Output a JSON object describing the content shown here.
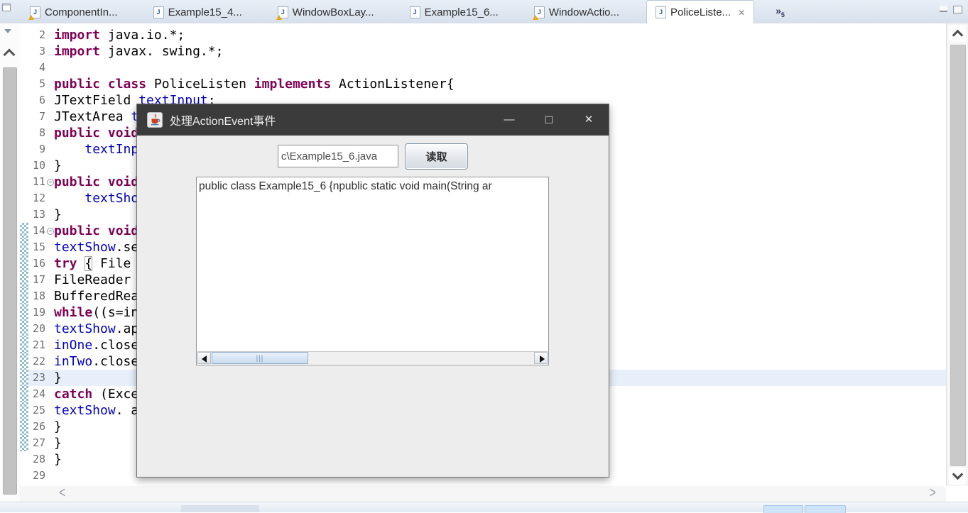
{
  "icons": {
    "close": "✕",
    "overflow": "»",
    "minimize": "—",
    "maximize": "□",
    "angle_left": "<",
    "angle_right": ">",
    "file_letter": "J",
    "grip": "|||"
  },
  "tab_bar": {
    "overflow_count": "5",
    "tabs": [
      {
        "label": "ComponentIn...",
        "warning": true,
        "active": false,
        "closable": false
      },
      {
        "label": "Example15_4...",
        "warning": false,
        "active": false,
        "closable": false
      },
      {
        "label": "WindowBoxLay...",
        "warning": true,
        "active": false,
        "closable": false
      },
      {
        "label": "Example15_6...",
        "warning": false,
        "active": false,
        "closable": false
      },
      {
        "label": "WindowActio...",
        "warning": true,
        "active": false,
        "closable": false
      },
      {
        "label": "PoliceListe...",
        "warning": false,
        "active": true,
        "closable": true
      }
    ]
  },
  "editor": {
    "current_line": 23,
    "fold_lines": [
      11,
      14
    ],
    "marker_range": [
      14,
      27
    ],
    "lines": [
      {
        "n": 2,
        "s": [
          [
            "k",
            "import"
          ],
          [
            "p",
            " java.io.*;"
          ]
        ]
      },
      {
        "n": 3,
        "s": [
          [
            "k",
            "import"
          ],
          [
            "p",
            " javax. swing.*;"
          ]
        ]
      },
      {
        "n": 4,
        "s": []
      },
      {
        "n": 5,
        "s": [
          [
            "k",
            "public"
          ],
          [
            "p",
            " "
          ],
          [
            "k",
            "class"
          ],
          [
            "p",
            " PoliceListen "
          ],
          [
            "k",
            "implements"
          ],
          [
            "p",
            " ActionListener{"
          ]
        ]
      },
      {
        "n": 6,
        "s": [
          [
            "p",
            "JTextField "
          ],
          [
            "e",
            "textInput"
          ],
          [
            "p",
            ";"
          ]
        ]
      },
      {
        "n": 7,
        "s": [
          [
            "p",
            "JTextArea "
          ],
          [
            "f",
            "textShow"
          ],
          [
            "p",
            ";"
          ]
        ]
      },
      {
        "n": 8,
        "s": [
          [
            "k",
            "public"
          ],
          [
            "p",
            " "
          ],
          [
            "k",
            "void"
          ]
        ]
      },
      {
        "n": 9,
        "s": [
          [
            "p",
            "    "
          ],
          [
            "f",
            "textInput"
          ]
        ]
      },
      {
        "n": 10,
        "s": [
          [
            "p",
            "}"
          ]
        ]
      },
      {
        "n": 11,
        "s": [
          [
            "k",
            "public"
          ],
          [
            "p",
            " "
          ],
          [
            "k",
            "void"
          ]
        ]
      },
      {
        "n": 12,
        "s": [
          [
            "p",
            "    "
          ],
          [
            "f",
            "textShow"
          ]
        ]
      },
      {
        "n": 13,
        "s": [
          [
            "p",
            "}"
          ]
        ]
      },
      {
        "n": 14,
        "s": [
          [
            "k",
            "public"
          ],
          [
            "p",
            " "
          ],
          [
            "k",
            "void"
          ]
        ]
      },
      {
        "n": 15,
        "s": [
          [
            "f",
            "textShow"
          ],
          [
            "p",
            ".se"
          ]
        ]
      },
      {
        "n": 16,
        "s": [
          [
            "k",
            "try"
          ],
          [
            "p",
            " "
          ],
          [
            "b",
            "{"
          ],
          [
            "p",
            " File"
          ]
        ]
      },
      {
        "n": 17,
        "s": [
          [
            "p",
            "FileReader "
          ]
        ]
      },
      {
        "n": 18,
        "s": [
          [
            "p",
            "BufferedRea"
          ]
        ]
      },
      {
        "n": 19,
        "s": [
          [
            "k",
            "while"
          ],
          [
            "p",
            "((s=in"
          ]
        ]
      },
      {
        "n": 20,
        "s": [
          [
            "f",
            "textShow"
          ],
          [
            "p",
            ".ap"
          ]
        ]
      },
      {
        "n": 21,
        "s": [
          [
            "f",
            "inOne"
          ],
          [
            "p",
            ".close"
          ]
        ]
      },
      {
        "n": 22,
        "s": [
          [
            "f",
            "inTwo"
          ],
          [
            "p",
            ".close"
          ]
        ]
      },
      {
        "n": 23,
        "s": [
          [
            "p",
            "}"
          ]
        ]
      },
      {
        "n": 24,
        "s": [
          [
            "k",
            "catch"
          ],
          [
            "p",
            " (Exce"
          ]
        ]
      },
      {
        "n": 25,
        "s": [
          [
            "f",
            "textShow"
          ],
          [
            "p",
            ". a"
          ]
        ]
      },
      {
        "n": 26,
        "s": [
          [
            "p",
            "}"
          ]
        ]
      },
      {
        "n": 27,
        "s": [
          [
            "p",
            "}"
          ]
        ]
      },
      {
        "n": 28,
        "s": [
          [
            "p",
            "}"
          ]
        ]
      },
      {
        "n": 29,
        "s": []
      }
    ]
  },
  "dialog": {
    "title": "处理ActionEvent事件",
    "file_path_value": "c\\Example15_6.java",
    "read_button_label": "读取",
    "textarea_text": "public class Example15_6 {npublic static void main(String ar"
  },
  "colors": {
    "titlebar": "#3b3b3b",
    "keyword": "#7f0055",
    "field_blue": "#0000c0",
    "current_line_highlight": "#e7effa",
    "marker_teal": "#93bfcd",
    "scroll_thumb_blue": "#c9dcf0",
    "tab_bar_bg": "#dce6f2"
  }
}
